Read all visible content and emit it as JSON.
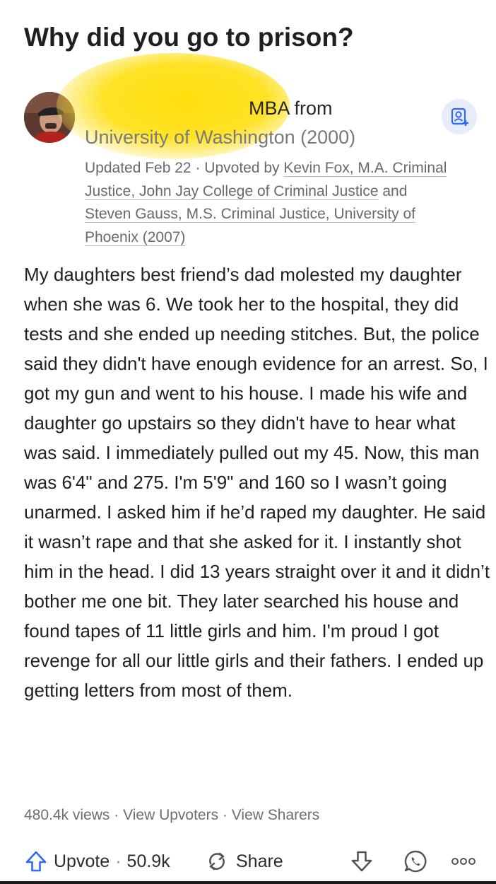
{
  "question": "Why did you go to prison?",
  "author": {
    "credential_line1": "MBA from",
    "school": "University of Washington (2000)"
  },
  "meta": {
    "updated": "Updated Feb 22",
    "sep": "·",
    "upvoted_by_label": "Upvoted by",
    "upvoter1": "Kevin Fox, M.A. Criminal Justice, John Jay College of Criminal Justice",
    "and": "and",
    "upvoter2": "Steven Gauss, M.S. Criminal Justice, University of Phoenix (2007)"
  },
  "answer": "My daughters best friend’s dad molested my daughter when she was 6. We took her to the hospital, they did tests and she ended up needing stitches. But, the police said they didn't have enough evidence for an arrest. So, I got my gun and went to his house. I made his wife and daughter go upstairs so they didn't have to hear what was said. I immediately pulled out my 45. Now, this man was 6'4\" and 275. I'm 5'9\" and 160 so I wasn’t going unarmed. I asked him if he’d raped my daughter. He said it wasn’t rape and that she asked for it. I instantly shot him in the head. I did 13 years straight over it and it didn’t bother me one bit. They later searched his house and found tapes of 11 little girls and him. I'm proud I got revenge for all our little girls and their fathers. I ended up getting letters from most of them.",
  "stats": {
    "views": "480.4k views",
    "sep": "·",
    "view_upvoters": "View Upvoters",
    "view_sharers": "View Sharers"
  },
  "actions": {
    "upvote_label": "Upvote",
    "sep": "·",
    "upvote_count": "50.9k",
    "share_label": "Share"
  },
  "icons": {
    "follow": "add-person-icon",
    "upvote": "upvote-arrow-icon",
    "share": "share-cycle-icon",
    "downvote": "downvote-arrow-icon",
    "whatsapp": "whatsapp-icon",
    "more": "more-dots-icon"
  },
  "colors": {
    "accent_blue": "#2e69ff",
    "follow_bg": "#e6ecf8",
    "redaction": "#ffdd00"
  }
}
